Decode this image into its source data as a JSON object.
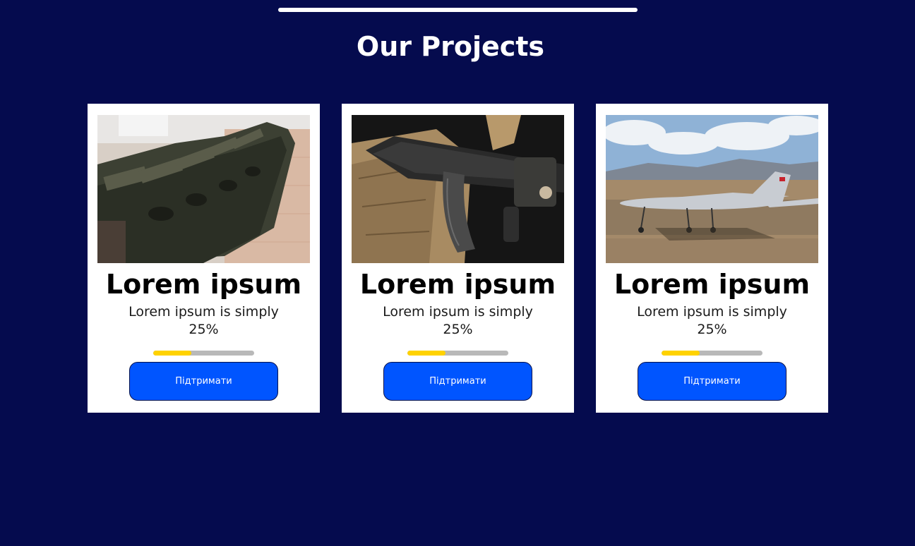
{
  "section": {
    "title": "Our Projects"
  },
  "projects": [
    {
      "image": "jerry-cans-photo",
      "title": "Lorem ipsum",
      "text": "Lorem ipsum is simply",
      "percent_label": "25%",
      "progress": 0.38,
      "button_label": "Підтримати"
    },
    {
      "image": "rifle-and-gear-photo",
      "title": "Lorem ipsum",
      "text": "Lorem ipsum is simply",
      "percent_label": "25%",
      "progress": 0.38,
      "button_label": "Підтримати"
    },
    {
      "image": "drone-on-airfield-photo",
      "title": "Lorem ipsum",
      "text": "Lorem ipsum is simply",
      "percent_label": "25%",
      "progress": 0.38,
      "button_label": "Підтримати"
    }
  ],
  "colors": {
    "background": "#050b4e",
    "card": "#ffffff",
    "button": "#0055ff",
    "progress_fill": "#ffd200",
    "progress_track": "#b9b9b9"
  }
}
